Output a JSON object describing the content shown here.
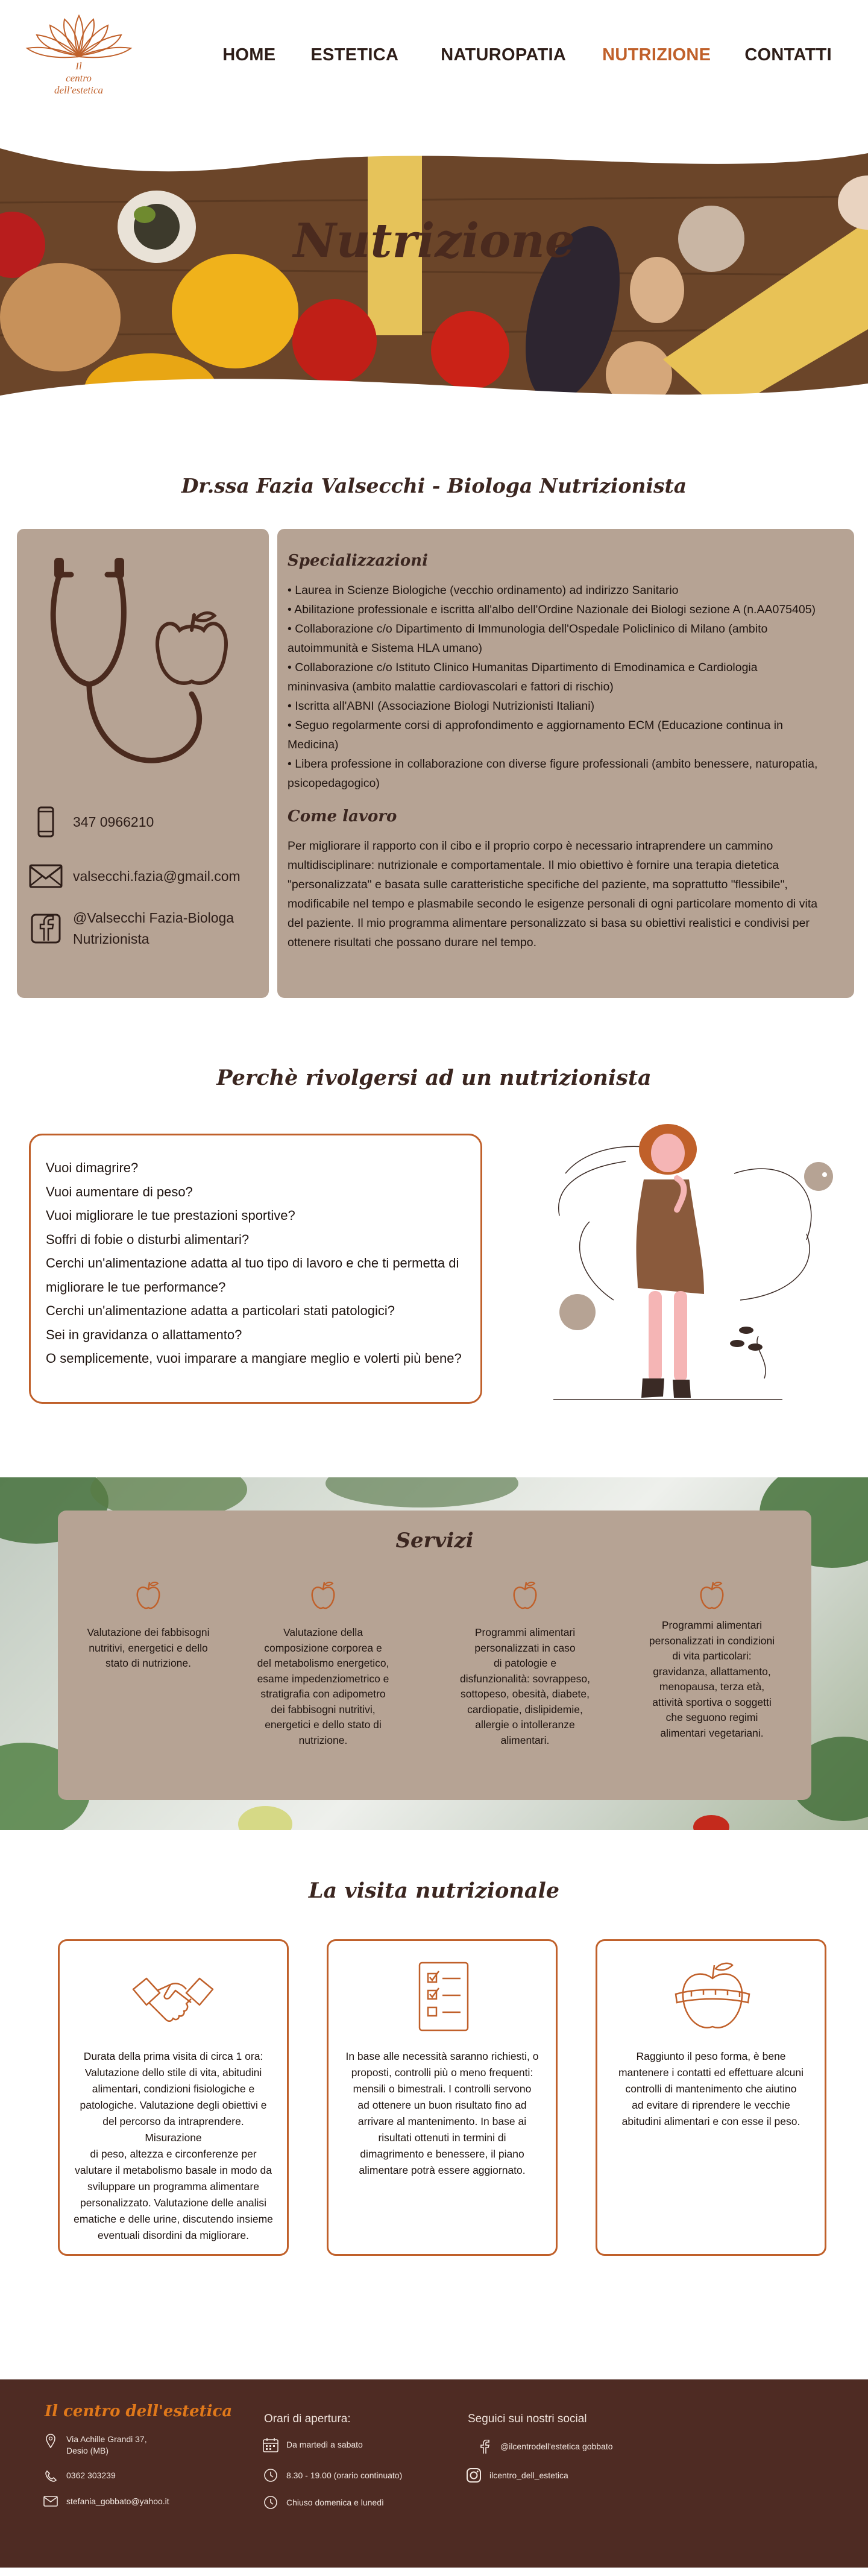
{
  "header": {
    "logo_line1": "Il",
    "logo_line2": "centro",
    "logo_line3": "dell'estetica",
    "nav": [
      {
        "label": "HOME",
        "active": false
      },
      {
        "label": "ESTETICA",
        "active": false
      },
      {
        "label": "NATUROPATIA",
        "active": false
      },
      {
        "label": "NUTRIZIONE",
        "active": true
      },
      {
        "label": "CONTATTI",
        "active": false
      }
    ]
  },
  "hero": {
    "title": "Nutrizione"
  },
  "doctor": {
    "title": "Dr.ssa Fazia Valsecchi - Biologa Nutrizionista",
    "phone": "347 0966210",
    "email": "valsecchi.fazia@gmail.com",
    "facebook_line1": "@Valsecchi Fazia-Biologa",
    "facebook_line2": "Nutrizionista",
    "spec_title": "Specializzazioni",
    "spec_lines": [
      "• Laurea in Scienze Biologiche (vecchio ordinamento) ad indirizzo Sanitario",
      " • Abilitazione professionale e iscritta all'albo dell'Ordine Nazionale dei Biologi sezione A (n.AA075405)",
      " • Collaborazione c/o Dipartimento di Immunologia dell'Ospedale Policlinico di Milano (ambito",
      "autoimmunità e Sistema HLA umano)",
      " • Collaborazione c/o Istituto Clinico Humanitas Dipartimento di Emodinamica e Cardiologia",
      "mininvasiva (ambito malattie cardiovascolari e fattori di rischio)",
      "• Iscritta all'ABNI (Associazione Biologi Nutrizionisti Italiani)",
      " • Seguo regolarmente corsi di approfondimento e aggiornamento ECM (Educazione continua in",
      "Medicina)",
      " • Libera professione in collaborazione con diverse figure professionali (ambito benessere, naturopatia,",
      "psicopedagogico)"
    ],
    "work_title": "Come lavoro",
    "work_lines": [
      "Per migliorare il rapporto con il cibo e il proprio corpo è necessario intraprendere un cammino",
      "multidisciplinare: nutrizionale e comportamentale. Il mio obiettivo è fornire una terapia dietetica",
      "\"personalizzata\" e basata sulle caratteristiche specifiche del paziente, ma soprattutto \"flessibile\",",
      "modificabile nel tempo e plasmabile secondo le esigenze personali di ogni particolare momento di vita",
      "del paziente. Il mio programma alimentare personalizzato si basa su obiettivi realistici e condivisi per",
      "ottenere risultati che possano durare nel tempo."
    ]
  },
  "perche": {
    "title": "Perchè rivolgersi ad un nutrizionista",
    "questions": [
      "Vuoi dimagrire?",
      "Vuoi aumentare di peso?",
      "Vuoi migliorare le tue prestazioni sportive?",
      "Soffri di fobie o disturbi alimentari?",
      "Cerchi un'alimentazione adatta al tuo tipo di lavoro e che ti permetta di",
      "migliorare le tue performance?",
      "Cerchi un'alimentazione adatta a particolari stati patologici?",
      "Sei in gravidanza o allattamento?",
      "O semplicemente, vuoi imparare a mangiare meglio e volerti più bene?"
    ]
  },
  "servizi": {
    "title": "Servizi",
    "items": [
      {
        "lines": [
          "Valutazione dei fabbisogni",
          "nutritivi, energetici e dello",
          "stato di nutrizione."
        ]
      },
      {
        "lines": [
          "Valutazione della",
          "composizione corporea e",
          "del metabolismo energetico,",
          "esame impedenziometrico e",
          "stratigrafia con adipometro",
          "dei fabbisogni nutritivi,",
          "energetici e dello stato di",
          "nutrizione."
        ]
      },
      {
        "lines": [
          "Programmi alimentari",
          "personalizzati in caso",
          "di patologie e",
          "disfunzionalità: sovrappeso,",
          "sottopeso, obesità, diabete,",
          "cardiopatie, dislipidemie,",
          "allergie o intolleranze",
          "alimentari."
        ]
      },
      {
        "lines": [
          "Programmi alimentari",
          "personalizzati in condizioni",
          "di vita particolari:",
          "gravidanza, allattamento,",
          "menopausa, terza età,",
          "attività sportiva o soggetti",
          "che seguono regimi",
          "alimentari vegetariani."
        ]
      }
    ]
  },
  "visita": {
    "title": "La visita nutrizionale",
    "cards": [
      {
        "icon": "handshake-icon",
        "lines": [
          "Durata della prima visita di circa 1 ora:",
          "Valutazione dello stile di vita, abitudini",
          "alimentari, condizioni fisiologiche e",
          "patologiche. Valutazione degli obiettivi e",
          "del percorso da intraprendere. Misurazione",
          "di peso, altezza e circonferenze per",
          "valutare il metabolismo basale in modo da",
          "sviluppare un programma alimentare",
          "personalizzato. Valutazione delle analisi",
          "ematiche e delle urine, discutendo insieme",
          "eventuali disordini da migliorare."
        ]
      },
      {
        "icon": "checklist-icon",
        "lines": [
          "In base alle necessità saranno richiesti, o",
          "proposti, controlli più o meno frequenti:",
          "mensili o bimestrali. I controlli servono",
          "ad ottenere un buon risultato fino ad",
          "arrivare al mantenimento. In base ai",
          "risultati ottenuti in termini di",
          "dimagrimento e benessere, il piano",
          "alimentare potrà essere aggiornato."
        ]
      },
      {
        "icon": "apple-tape-icon",
        "lines": [
          "Raggiunto il peso forma, è bene",
          "mantenere i contatti ed effettuare alcuni",
          "controlli di mantenimento che aiutino",
          "ad evitare di riprendere le vecchie",
          "abitudini alimentari e con esse il peso."
        ]
      }
    ]
  },
  "footer": {
    "brand": "Il centro dell'estetica",
    "address_line1": "Via Achille Grandi 37,",
    "address_line2": "Desio (MB)",
    "phone": "0362 303239",
    "email": "stefania_gobbato@yahoo.it",
    "hours_title": "Orari di apertura:",
    "days": "Da martedì a sabato",
    "time": "8.30 - 19.00 (orario continuato)",
    "closed": "Chiuso domenica e lunedì",
    "social_title": "Seguici sui nostri social",
    "facebook": "@ilcentrodell'estetica gobbato",
    "instagram": "ilcentro_dell_estetica"
  },
  "colors": {
    "accent": "#c0602a",
    "card_bg": "#b6a394",
    "footer_bg": "#4e2b23",
    "footer_brand": "#e0781a",
    "heading": "#3b2620"
  }
}
